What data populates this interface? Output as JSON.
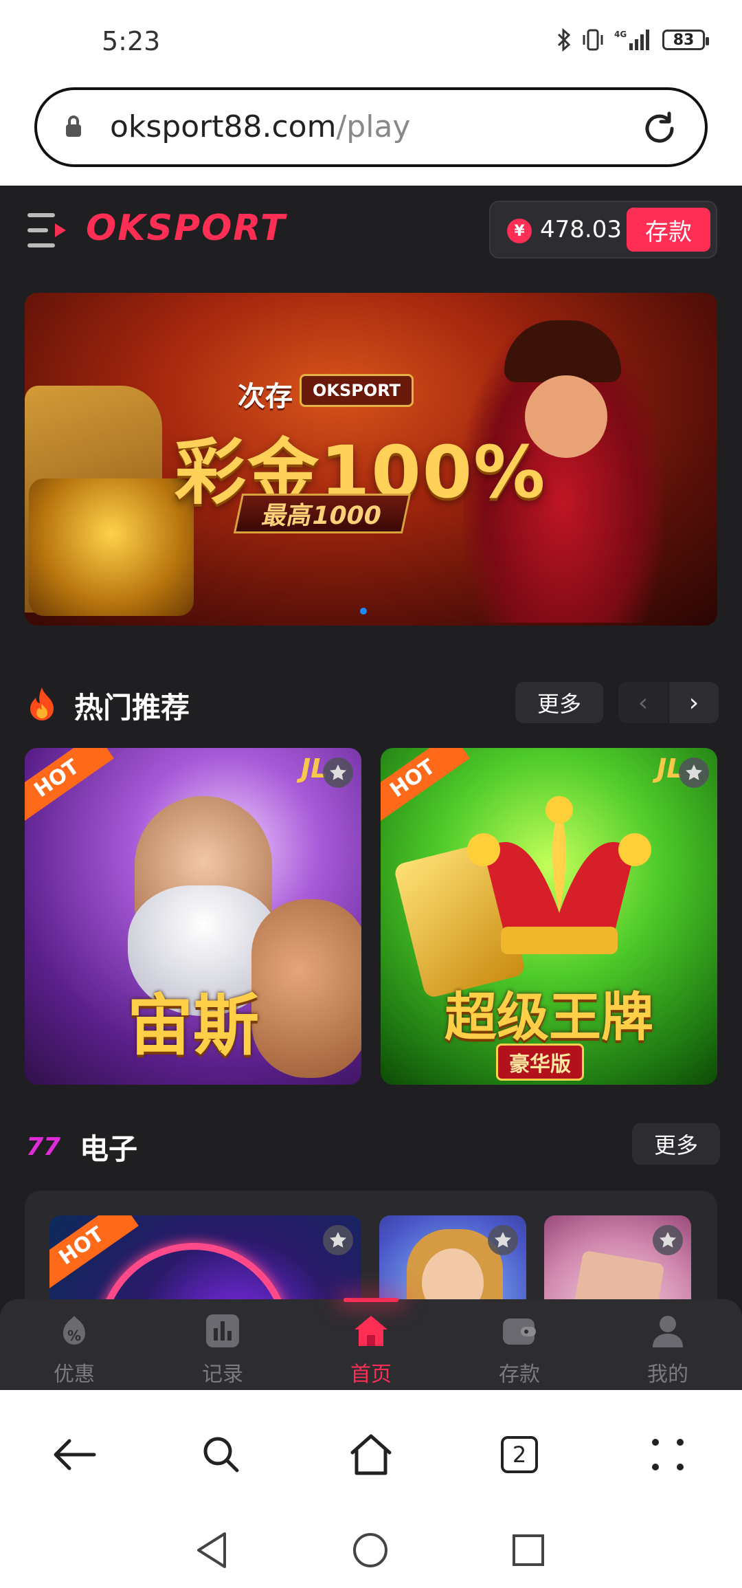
{
  "status_bar": {
    "time": "5:23",
    "battery": "83",
    "network": "4G",
    "icons": [
      "bluetooth-icon",
      "vibrate-icon",
      "signal-icon",
      "battery-icon"
    ]
  },
  "browser": {
    "url_host": "oksport88.com",
    "url_path": "/play",
    "tab_count": "2"
  },
  "app": {
    "logo": "OKSPORT",
    "balance": "478.03",
    "currency_symbol": "¥",
    "deposit_label": "存款",
    "accent_color": "#ff2e55"
  },
  "banner": {
    "small_text": "次存",
    "badge": "OKSPORT",
    "title": "彩金100%",
    "subtitle": "最高1000"
  },
  "hot_section": {
    "title": "热门推荐",
    "more_label": "更多",
    "arrow_left": "‹",
    "arrow_right": "›",
    "games": [
      {
        "name": "宙斯",
        "ribbon": "HOT",
        "provider": "JL"
      },
      {
        "name": "超级王牌",
        "subtitle": "豪华版",
        "ribbon": "HOT",
        "provider": "JL"
      }
    ]
  },
  "electronic_section": {
    "title": "电子",
    "more_label": "更多",
    "games": [
      {
        "ribbon": "HOT"
      },
      {
        "ribbon": ""
      },
      {
        "ribbon": ""
      }
    ]
  },
  "tab_bar": {
    "items": [
      {
        "label": "优惠",
        "icon": "discount-icon"
      },
      {
        "label": "记录",
        "icon": "records-icon"
      },
      {
        "label": "首页",
        "icon": "home-icon",
        "active": true
      },
      {
        "label": "存款",
        "icon": "wallet-icon"
      },
      {
        "label": "我的",
        "icon": "profile-icon"
      }
    ]
  }
}
